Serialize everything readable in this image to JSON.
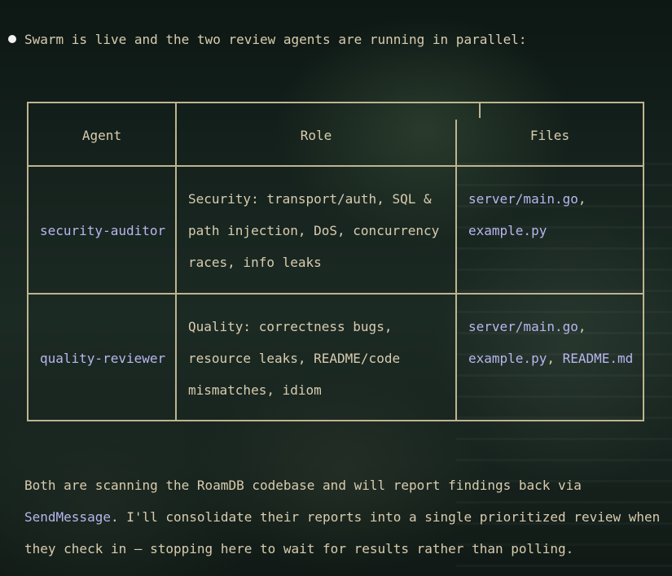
{
  "intro": {
    "text": "Swarm is live and the two review agents are running in parallel:"
  },
  "table": {
    "headers": [
      "Agent",
      "Role",
      "Files"
    ],
    "rows": [
      {
        "agent": "security-auditor",
        "role_lines": [
          "Security: transport/auth, SQL &",
          "path injection, DoS, concurrency",
          "races, info leaks"
        ],
        "files_lines": [
          [
            {
              "text": "server/main.go",
              "code": true
            },
            {
              "text": ",",
              "code": false
            }
          ],
          [
            {
              "text": "example.py",
              "code": true
            }
          ]
        ]
      },
      {
        "agent": "quality-reviewer",
        "role_lines": [
          "Quality: correctness bugs,",
          "resource leaks, README/code",
          "mismatches, idiom"
        ],
        "files_lines": [
          [
            {
              "text": "server/main.go",
              "code": true
            },
            {
              "text": ",",
              "code": false
            }
          ],
          [
            {
              "text": "example.py",
              "code": true
            },
            {
              "text": ", ",
              "code": false
            },
            {
              "text": "README.md",
              "code": true
            }
          ]
        ]
      }
    ]
  },
  "summary": {
    "line1": "Both are scanning the RoamDB codebase and will report findings back via",
    "line2_code": "SendMessage",
    "line2_rest": ". I'll consolidate their reports into a single prioritized review when",
    "line3": "they check in — stopping here to wait for results rather than polling."
  },
  "colors": {
    "text": "#d8ccae",
    "code": "#b8b6ee",
    "border": "#bfb48f",
    "bullet": "#f2f2f2"
  }
}
